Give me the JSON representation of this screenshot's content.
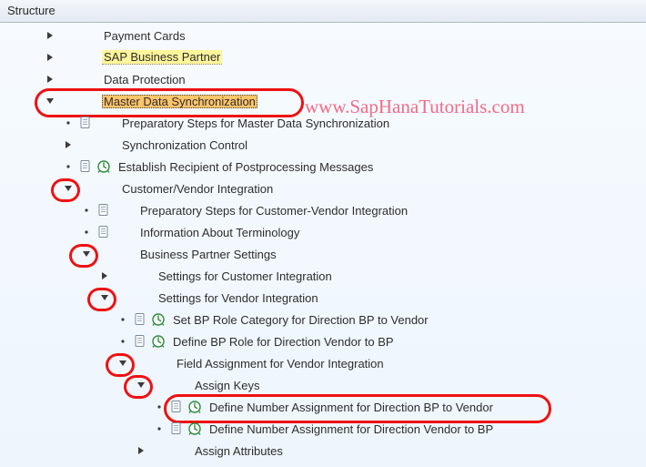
{
  "header": {
    "title": "Structure"
  },
  "watermark": "www.SapHanaTutorials.com",
  "nodes": [
    {
      "indent": 40,
      "caret": "right",
      "marks": "",
      "label": "Payment Cards"
    },
    {
      "indent": 40,
      "caret": "right",
      "marks": "",
      "label": "SAP Business Partner",
      "hl": "yellow"
    },
    {
      "indent": 40,
      "caret": "right",
      "marks": "",
      "label": "Data Protection"
    },
    {
      "indent": 40,
      "caret": "down",
      "marks": "",
      "label": "Master Data Synchronization",
      "hl": "orange",
      "ring_main": true
    },
    {
      "indent": 60,
      "caret": "dot",
      "marks": "doc",
      "label": "Preparatory Steps for Master Data Synchronization"
    },
    {
      "indent": 60,
      "caret": "right",
      "marks": "",
      "label": "Synchronization Control"
    },
    {
      "indent": 60,
      "caret": "dot",
      "marks": "doc,clock",
      "label": "Establish Recipient of Postprocessing Messages"
    },
    {
      "indent": 60,
      "caret": "down",
      "marks": "",
      "label": "Customer/Vendor Integration",
      "ring": true
    },
    {
      "indent": 80,
      "caret": "dot",
      "marks": "doc",
      "label": "Preparatory Steps for Customer-Vendor Integration"
    },
    {
      "indent": 80,
      "caret": "dot",
      "marks": "doc",
      "label": "Information About Terminology"
    },
    {
      "indent": 80,
      "caret": "down",
      "marks": "",
      "label": "Business Partner Settings",
      "ring": true
    },
    {
      "indent": 100,
      "caret": "right",
      "marks": "",
      "label": "Settings for Customer Integration"
    },
    {
      "indent": 100,
      "caret": "down",
      "marks": "",
      "label": "Settings for Vendor Integration",
      "ring": true
    },
    {
      "indent": 120,
      "caret": "dot",
      "marks": "doc,clock",
      "label": "Set BP Role Category for Direction BP to Vendor"
    },
    {
      "indent": 120,
      "caret": "dot",
      "marks": "doc,clock",
      "label": "Define BP Role for Direction Vendor to BP"
    },
    {
      "indent": 120,
      "caret": "down",
      "marks": "",
      "label": "Field Assignment for Vendor Integration",
      "ring": true
    },
    {
      "indent": 140,
      "caret": "down",
      "marks": "",
      "label": "Assign Keys",
      "ring": true
    },
    {
      "indent": 160,
      "caret": "dot",
      "marks": "doc,clock",
      "label": "Define Number Assignment for Direction BP to Vendor",
      "ring_row": true
    },
    {
      "indent": 160,
      "caret": "dot",
      "marks": "doc,clock",
      "label": "Define Number Assignment for Direction Vendor to BP"
    },
    {
      "indent": 140,
      "caret": "right",
      "marks": "",
      "label": "Assign Attributes"
    }
  ]
}
